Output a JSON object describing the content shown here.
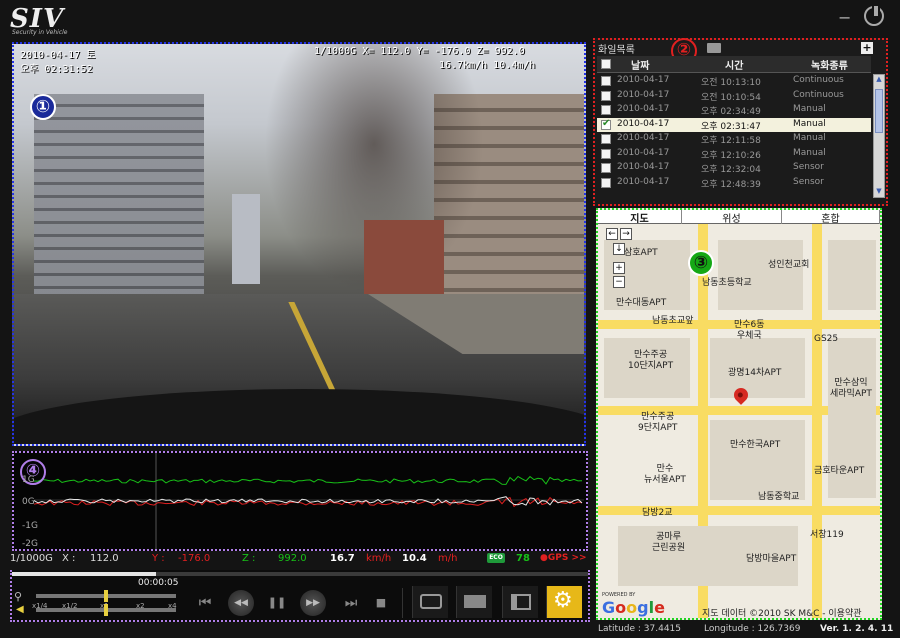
{
  "header": {
    "logo": "SIV",
    "logo_sub": "Security in Vehicle",
    "minimize_label": "−"
  },
  "video": {
    "badge": "①",
    "date": "2010-04-17 토",
    "time": "오후 02:31:52",
    "gsensor": "1/1000G  X= 112.0 Y= -176.0 Z=  992.0",
    "speed": "16.7km/h 10.4m/h"
  },
  "filelist": {
    "title": "화일목록",
    "badge": "②",
    "add_label": "+",
    "headers": {
      "date": "날짜",
      "time": "시간",
      "type": "녹화종류"
    },
    "rows": [
      {
        "date": "2010-04-17",
        "time": "오전 10:13:10",
        "type": "Continuous",
        "selected": false
      },
      {
        "date": "2010-04-17",
        "time": "오전 10:10:54",
        "type": "Continuous",
        "selected": false
      },
      {
        "date": "2010-04-17",
        "time": "오후 02:34:49",
        "type": "Manual",
        "selected": false
      },
      {
        "date": "2010-04-17",
        "time": "오후 02:31:47",
        "type": "Manual",
        "selected": true
      },
      {
        "date": "2010-04-17",
        "time": "오후 12:11:58",
        "type": "Manual",
        "selected": false
      },
      {
        "date": "2010-04-17",
        "time": "오후 12:10:26",
        "type": "Manual",
        "selected": false
      },
      {
        "date": "2010-04-17",
        "time": "오후 12:32:04",
        "type": "Sensor",
        "selected": false
      },
      {
        "date": "2010-04-17",
        "time": "오후 12:48:39",
        "type": "Sensor",
        "selected": false
      }
    ]
  },
  "map": {
    "badge": "③",
    "tabs": [
      "지도",
      "위성",
      "혼합"
    ],
    "labels": {
      "samho": "삼호APT",
      "church": "성인천교회",
      "school1": "남동초등학교",
      "mansu_dae": "만수대동APT",
      "namdong_cho": "남동초교앞",
      "post": "만수6동\n우체국",
      "gs25": "GS25",
      "mansu_10": "만수주공\n10단지APT",
      "gwangmyung": "광명14차APT",
      "mansu_sam": "만수삼익\n세라믹APT",
      "mansu_9": "만수주공\n9단지APT",
      "mansu_hanguk": "만수한국APT",
      "newseoul": "만수\n뉴서울APT",
      "geumho": "금호타운APT",
      "middle": "남동중학교",
      "dambang2": "담방2교",
      "seochang": "서창119",
      "park": "공마루\n근린공원",
      "dambang_apt": "담방마을APT"
    },
    "powered": "POWERED BY",
    "google": "Google",
    "copyright": "지도 데이터 ©2010 SK M&C - 이용약관"
  },
  "graph": {
    "badge": "④",
    "ylabels": [
      "1G",
      "0G",
      "-1G",
      "-2G"
    ]
  },
  "readout": {
    "scale": "1/1000G",
    "x_label": "X :",
    "x_value": "112.0",
    "y_label": "Y :",
    "y_value": "-176.0",
    "z_label": "Z :",
    "z_value": "992.0",
    "kmh_value": "16.7",
    "kmh_unit": "km/h",
    "mh_value": "10.4",
    "mh_unit": "m/h",
    "eco": "ECO",
    "eco_value": "78",
    "gps": "●GPS >>"
  },
  "player": {
    "time": "00:00:05",
    "progress": 0.25,
    "speed_ticks": [
      "x1/4",
      "x1/2",
      "x1",
      "x2",
      "x4"
    ],
    "controls": {
      "prev": "⏮",
      "rewind": "◀◀",
      "pause": "❚❚",
      "forward": "▶▶",
      "next": "⏭",
      "stop": "■"
    }
  },
  "footer": {
    "latitude": "Latitude : 37.4415",
    "longitude": "Longitude : 126.7369",
    "version": "Ver. 1. 2. 4. 11"
  },
  "colors": {
    "video_border": "#2433e6",
    "filelist_border": "#e02020",
    "map_border": "#22d322",
    "graph_border": "#b07ee8",
    "map_road": "#f9dc62",
    "settings_accent": "#e7b818"
  }
}
